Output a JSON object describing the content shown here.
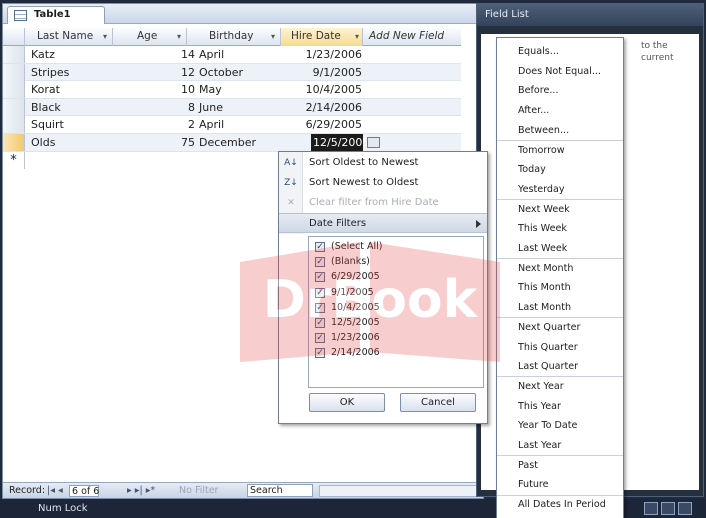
{
  "table": {
    "tab_title": "Table1",
    "columns": {
      "last_name": "Last Name",
      "age": "Age",
      "birthday": "Birthday",
      "hire_date": "Hire Date",
      "add_new": "Add New Field"
    },
    "rows": [
      {
        "last_name": "Katz",
        "age": "14",
        "birthday": "April",
        "hire_date": "1/23/2006"
      },
      {
        "last_name": "Stripes",
        "age": "12",
        "birthday": "October",
        "hire_date": "9/1/2005"
      },
      {
        "last_name": "Korat",
        "age": "10",
        "birthday": "May",
        "hire_date": "10/4/2005"
      },
      {
        "last_name": "Black",
        "age": "8",
        "birthday": "June",
        "hire_date": "2/14/2006"
      },
      {
        "last_name": "Squirt",
        "age": "2",
        "birthday": "April",
        "hire_date": "6/29/2005"
      },
      {
        "last_name": "Olds",
        "age": "75",
        "birthday": "December",
        "hire_date": "12/5/2005"
      }
    ],
    "new_row_marker": "*"
  },
  "status": {
    "record_label": "Record:",
    "record_value": "6 of 6",
    "nav_first_prev": "|◂ ◂",
    "nav_next_last": "▸ ▸| ▸*",
    "no_filter": "No Filter",
    "search_placeholder": "Search"
  },
  "app_status": {
    "num_lock": "Num Lock"
  },
  "field_list": {
    "title": "Field List",
    "body_text": "to the current"
  },
  "filter_menu": {
    "sort_asc": "Sort Oldest to Newest",
    "sort_desc": "Sort Newest to Oldest",
    "clear_filter": "Clear filter from Hire Date",
    "date_filters": "Date Filters",
    "checklist": [
      "(Select All)",
      "(Blanks)",
      "6/29/2005",
      "9/1/2005",
      "10/4/2005",
      "12/5/2005",
      "1/23/2006",
      "2/14/2006"
    ],
    "ok": "OK",
    "cancel": "Cancel"
  },
  "date_submenu": {
    "items": [
      "Equals...",
      "Does Not Equal...",
      "Before...",
      "After...",
      "Between...",
      "Tomorrow",
      "Today",
      "Yesterday",
      "Next Week",
      "This Week",
      "Last Week",
      "Next Month",
      "This Month",
      "Last Month",
      "Next Quarter",
      "This Quarter",
      "Last Quarter",
      "Next Year",
      "This Year",
      "Year To Date",
      "Last Year",
      "Past",
      "Future",
      "All Dates In Period"
    ]
  },
  "watermark": {
    "text": "DrBook"
  },
  "colors": {
    "accent": "#f6da8e",
    "selection": "#1b1b1b",
    "header": "#dde5f0"
  }
}
